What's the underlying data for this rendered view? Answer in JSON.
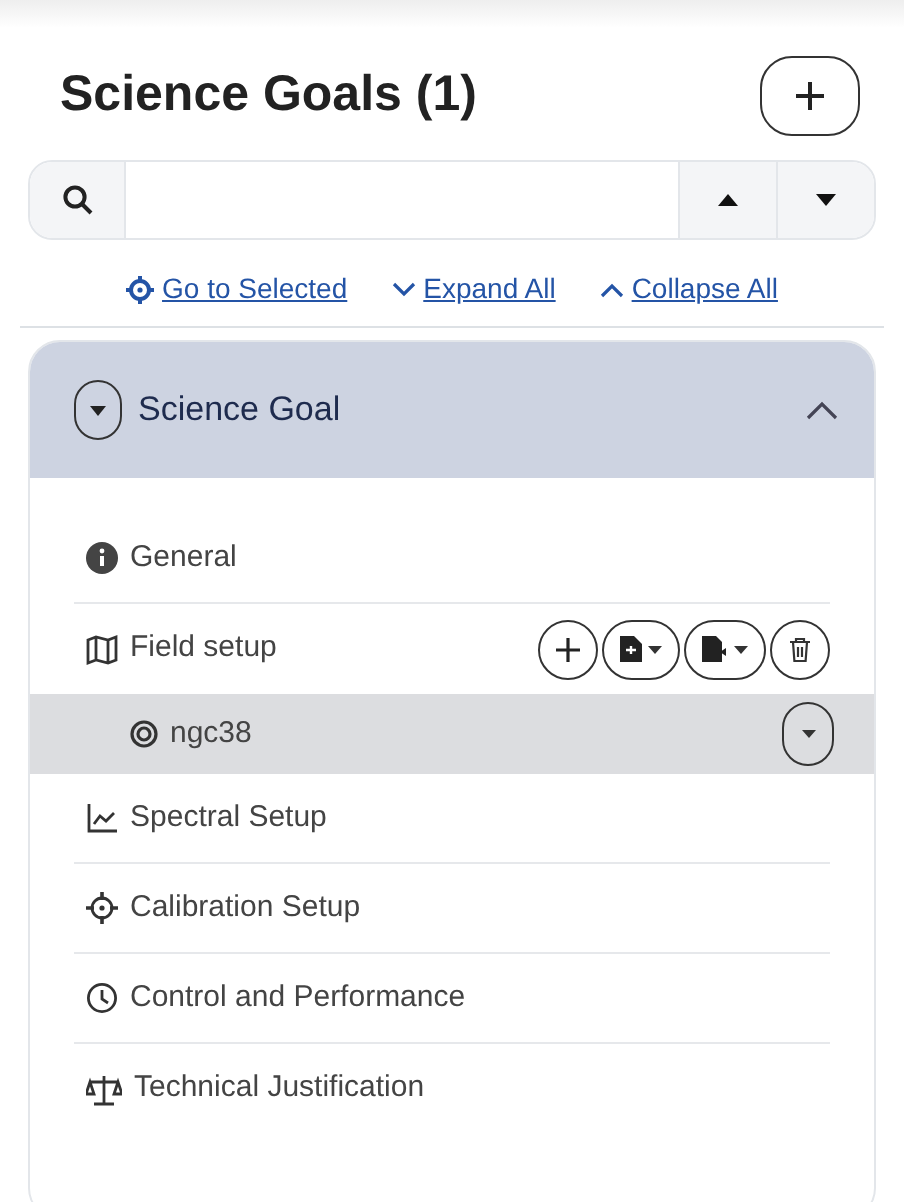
{
  "panel": {
    "title": "Science Goals (1)"
  },
  "links": [
    {
      "label": "Go to Selected"
    },
    {
      "label": "Expand All"
    },
    {
      "label": "Collapse All"
    }
  ],
  "goal": {
    "label": "Science Goal",
    "expanded": true
  },
  "sections": [
    {
      "label": "General"
    },
    {
      "label": "Field setup",
      "children": [
        {
          "label": "ngc38",
          "selected": true
        }
      ]
    },
    {
      "label": "Spectral Setup"
    },
    {
      "label": "Calibration Setup"
    },
    {
      "label": "Control and Performance"
    },
    {
      "label": "Technical Justification"
    }
  ]
}
